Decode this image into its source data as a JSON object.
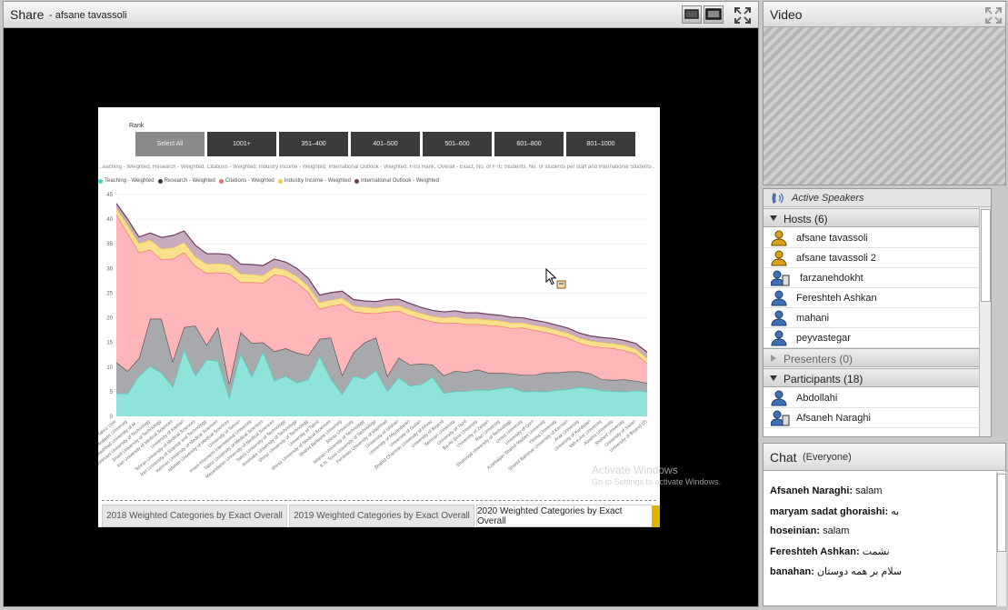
{
  "share": {
    "title": "Share",
    "presenter": "- afsane tavassoli"
  },
  "report": {
    "rank_label": "Rank",
    "slicers": [
      "Select All",
      "1001+",
      "351–400",
      "401–500",
      "501–600",
      "601–800",
      "801–1000"
    ],
    "filter_line": "...eaching - Weighted, Research - Weighted, Citations - Weighted, Industry Income - Weighted, International Outlook - Weighted, First Rank, Overall - Exact, No. of FTE Students, No. of students per staff and International Students ...",
    "legend": [
      {
        "name": "Teaching - Weighted",
        "color": "#3fd6c4"
      },
      {
        "name": "Research - Weighted",
        "color": "#3a3a3a"
      },
      {
        "name": "Citations - Weighted",
        "color": "#f26d6d"
      },
      {
        "name": "Industry Income - Weighted",
        "color": "#f2c94c"
      },
      {
        "name": "International Outlook - Weighted",
        "color": "#6b3d5e"
      }
    ],
    "tabs": [
      {
        "label": "2018 Weighted Categories by Exact Overall"
      },
      {
        "label": "2019 Weighted Categories by Exact Overall"
      },
      {
        "label": "2020 Weighted Categories by Exact Overall"
      }
    ]
  },
  "chart_data": {
    "type": "area",
    "stacked": true,
    "ylim": [
      0,
      45
    ],
    "yticks": [
      0,
      5,
      10,
      15,
      20,
      25,
      30,
      35,
      40,
      45
    ],
    "grid": true,
    "legend_position": "top-left",
    "categories": [
      "Tabriz Univ",
      "Tarbiat Modares University",
      "Mashhad University of M...",
      "Babol Noshirvani University of Technology",
      "Sharif University of Technology",
      "Iran University of Medical Sciences",
      "University of Kashan",
      "Tehran University of Medical Sciences",
      "Iran University of Science and Technology",
      "Kerman University of Medical Sciences",
      "Isfahan University of Medical Sciences",
      "University of Tehran",
      "Imam Khomeini International University",
      "Tabriz University of Medical Sciences",
      "Mazandaran University of Medical Sciences",
      "Tabriz University of Technology",
      "Amirkabir University of Technology",
      "Shiraz University of Technology",
      "University of Tabriz",
      "Shiraz University of Medical Sciences",
      "Shahid Beheshti University",
      "Shiraz University",
      "Isfahan University of Technology",
      "K.N. Toosi University of Technology",
      "Ferdowsi University of Mashhad",
      "University of Isfahan",
      "University of Mazandaran",
      "University of Guilan",
      "Shahid Chamran University of Ahvaz",
      "University of Birjand",
      "Semnan University",
      "University of Yazd",
      "Bu-Ali Sina University",
      "University of Zanjan",
      "Razi University",
      "Shahrood University of Technology",
      "Urmia University",
      "University of Qom",
      "Azarbaijan Shahid Madani University",
      "Yasouj University",
      "Shahid Bahonar University of Kerman",
      "Arak University",
      "University of Kurdistan",
      "Vali-e-Asr University",
      "Alzahra University",
      "Shahed University",
      "University of Sistan",
      "University of Birjand (2)"
    ],
    "series": [
      {
        "name": "Teaching - Weighted",
        "values": [
          4.6,
          4.6,
          8.2,
          10.2,
          8.8,
          6.0,
          13.5,
          8.2,
          11.5,
          11.2,
          3.8,
          12.8,
          8.0,
          13.2,
          7.2,
          8.2,
          6.8,
          7.5,
          12.2,
          7.6,
          4.5,
          8.2,
          7.6,
          9.3,
          5.1,
          7.9,
          6.2,
          6.5,
          8.0,
          4.7,
          5.1,
          5.1,
          5.4,
          5.3,
          5.7,
          5.9,
          5.0,
          5.1,
          5.0,
          5.3,
          5.5,
          5.9,
          5.7,
          5.2,
          5.1,
          5.0,
          5.2,
          5.0
        ]
      },
      {
        "name": "Research - Weighted",
        "values": [
          6.4,
          4.6,
          3.6,
          9.6,
          11.0,
          5.2,
          4.6,
          10.2,
          3.0,
          6.9,
          2.8,
          4.3,
          6.9,
          1.8,
          6.0,
          5.6,
          6.1,
          4.9,
          3.5,
          8.4,
          3.9,
          4.8,
          7.4,
          6.7,
          3.1,
          4.0,
          4.3,
          4.2,
          2.5,
          3.6,
          4.1,
          3.9,
          4.1,
          3.5,
          3.1,
          2.8,
          3.4,
          3.3,
          3.9,
          3.6,
          3.6,
          3.2,
          3.0,
          2.3,
          2.3,
          2.5,
          2.0,
          1.8
        ]
      },
      {
        "name": "Citations - Weighted",
        "values": [
          30.0,
          28.0,
          21.5,
          14.0,
          12.0,
          20.8,
          15.2,
          12.1,
          14.6,
          11.1,
          22.4,
          10.1,
          12.3,
          12.1,
          15.6,
          14.6,
          14.2,
          12.8,
          6.1,
          6.4,
          14.4,
          8.3,
          6.0,
          4.9,
          13.0,
          9.5,
          10.0,
          9.1,
          8.7,
          10.6,
          9.8,
          9.7,
          9.2,
          9.7,
          9.5,
          9.2,
          9.6,
          9.1,
          8.2,
          7.6,
          6.8,
          5.8,
          5.6,
          6.5,
          6.4,
          5.9,
          5.5,
          4.0
        ]
      },
      {
        "name": "Industry Income - Weighted",
        "values": [
          1.2,
          1.6,
          1.8,
          2.0,
          2.2,
          2.2,
          2.0,
          1.9,
          1.8,
          1.8,
          1.8,
          1.7,
          1.6,
          1.5,
          1.4,
          1.3,
          1.3,
          1.2,
          1.3,
          1.2,
          1.2,
          1.1,
          1.2,
          1.1,
          1.2,
          1.1,
          1.1,
          1.1,
          1.1,
          1.1,
          1.2,
          1.1,
          1.1,
          1.1,
          1.1,
          1.1,
          1.0,
          1.0,
          1.0,
          1.0,
          1.0,
          1.0,
          1.0,
          1.0,
          1.0,
          1.0,
          1.0,
          1.0
        ]
      },
      {
        "name": "International Outlook - Weighted",
        "values": [
          1.0,
          1.2,
          1.3,
          1.4,
          2.3,
          2.5,
          2.3,
          2.3,
          2.1,
          2.0,
          2.0,
          2.0,
          2.0,
          2.0,
          1.7,
          1.6,
          1.6,
          1.6,
          1.5,
          1.5,
          1.4,
          1.3,
          1.2,
          1.3,
          1.3,
          1.3,
          1.3,
          1.2,
          1.2,
          1.2,
          1.2,
          1.2,
          1.2,
          1.1,
          1.1,
          1.1,
          1.0,
          1.0,
          1.0,
          1.0,
          1.0,
          1.0,
          1.0,
          1.0,
          1.0,
          1.0,
          1.1,
          1.2
        ]
      }
    ]
  },
  "watermark": {
    "line1": "Activate Windows",
    "line2": "Go to Settings to activate Windows."
  },
  "video": {
    "title": "Video"
  },
  "attendees": {
    "active_speakers": "Active Speakers",
    "hosts_label": "Hosts (6)",
    "hosts": [
      "afsane tavassoli",
      "afsane tavassoli 2",
      "farzanehdokht",
      "Fereshteh Ashkan",
      "mahani",
      "peyvastegar"
    ],
    "presenters_label": "Presenters (0)",
    "participants_label": "Participants (18)",
    "participants": [
      "Abdollahi",
      "Afsaneh Naraghi"
    ]
  },
  "chat": {
    "title": "Chat",
    "scope": "(Everyone)",
    "messages": [
      {
        "sender": "Afsaneh Naraghi:",
        "text": "salam"
      },
      {
        "sender": "maryam sadat ghoraishi:",
        "text": "به"
      },
      {
        "sender": "hoseinian:",
        "text": "salam"
      },
      {
        "sender": "Fereshteh Ashkan:",
        "text": "نشمت"
      },
      {
        "sender": "banahan:",
        "text": "سلام بر همه دوستان"
      }
    ]
  },
  "colors": {
    "teaching": "#8fe3d8",
    "research": "#a7a9ac",
    "citations": "#ffb6b8",
    "industry": "#f9e08a",
    "international": "#c7abc0",
    "host_icon": "#d8a21a",
    "participant_icon": "#3f6fb5"
  }
}
